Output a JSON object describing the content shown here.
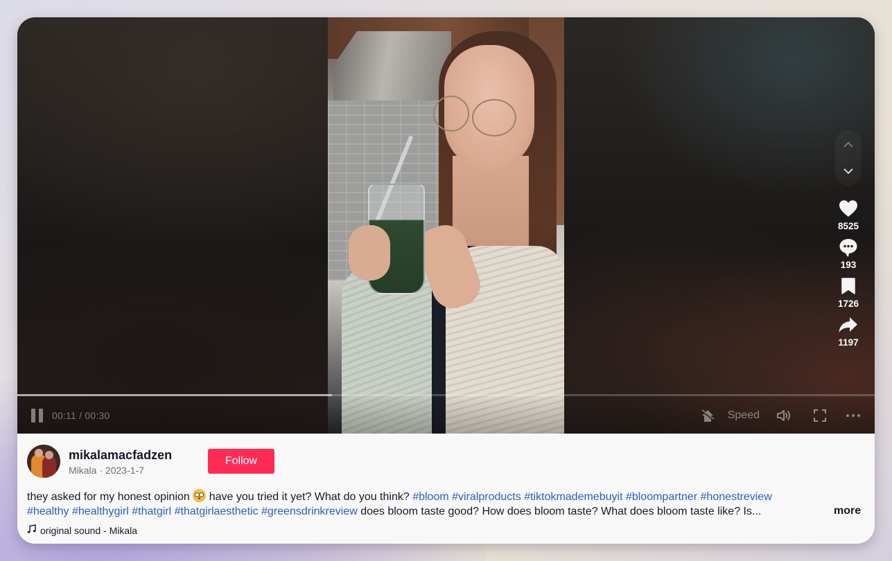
{
  "player": {
    "current_time": "00:11",
    "duration": "00:30",
    "time_separator": " / ",
    "progress_fraction": 0.367,
    "speed_label": "Speed",
    "state": "playing"
  },
  "actions": {
    "likes": "8525",
    "comments": "193",
    "saves": "1726",
    "shares": "1197"
  },
  "icons": {
    "pause": "pause-icon",
    "floating_player": "floating-player-off-icon",
    "volume": "volume-icon",
    "fullscreen": "fullscreen-icon",
    "more": "more-horizontal-icon",
    "nav_up": "chevron-up-icon",
    "nav_down": "chevron-down-icon",
    "like": "heart-icon",
    "comment": "comment-icon",
    "save": "bookmark-icon",
    "share": "share-arrow-icon",
    "music": "music-note-icon"
  },
  "author": {
    "username": "mikalamacfadzen",
    "display_name": "Mikala",
    "date": "2023-1-7",
    "separator": " · ",
    "follow_label": "Follow"
  },
  "description": {
    "text_before": "they asked for my honest opinion ",
    "emoji": "flushed-face",
    "text_after": " have you tried it yet? What do you think? ",
    "hashtags_line1": [
      "#bloom",
      "#viralproducts",
      "#tiktokmademebuyit",
      "#bloompartner",
      "#honestreview"
    ],
    "hashtags_line2": [
      "#healthy",
      "#healthygirl",
      "#thatgirl",
      "#thatgirlaesthetic",
      "#greensdrinkreview"
    ],
    "text_tail": " does bloom taste good? How does bloom taste? What does bloom taste like? Is...",
    "more_label": "more"
  },
  "sound": {
    "label": "original sound - Mikala"
  },
  "colors": {
    "follow": "#fe2c55",
    "hashtag": "#2b5db9",
    "text": "#161823"
  }
}
